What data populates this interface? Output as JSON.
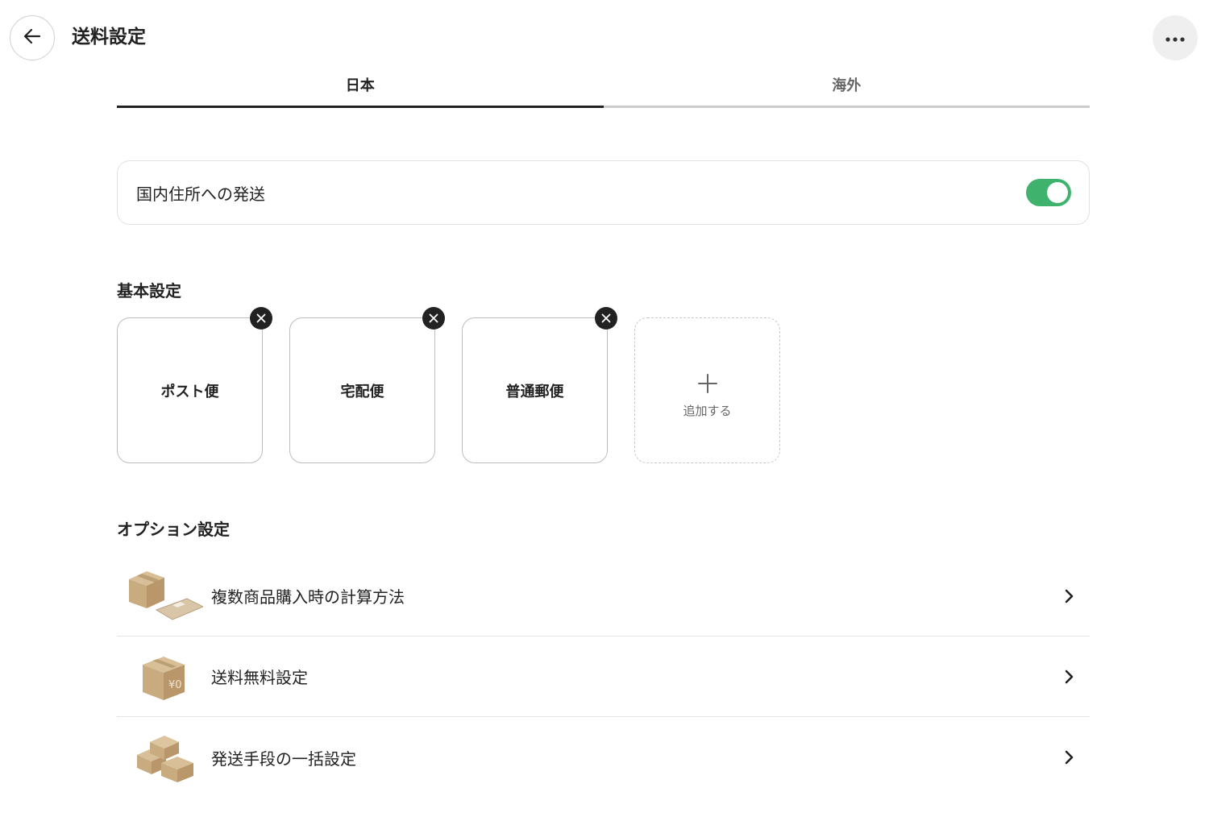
{
  "header": {
    "title": "送料設定",
    "back_icon": "arrow-left-icon",
    "more_icon": "more-horizontal-icon"
  },
  "tabs": [
    {
      "label": "日本",
      "active": true
    },
    {
      "label": "海外",
      "active": false
    }
  ],
  "domestic_toggle": {
    "label": "国内住所への発送",
    "enabled": true,
    "color": "#3fb36e"
  },
  "basic_settings": {
    "heading": "基本設定",
    "methods": [
      {
        "label": "ポスト便"
      },
      {
        "label": "宅配便"
      },
      {
        "label": "普通郵便"
      }
    ],
    "add_label": "追加する"
  },
  "option_settings": {
    "heading": "オプション設定",
    "items": [
      {
        "label": "複数商品購入時の計算方法",
        "icon": "box-and-envelope-icon"
      },
      {
        "label": "送料無料設定",
        "icon": "box-yen-zero-icon",
        "icon_text": "¥0"
      },
      {
        "label": "発送手段の一括設定",
        "icon": "stacked-boxes-icon"
      }
    ]
  }
}
